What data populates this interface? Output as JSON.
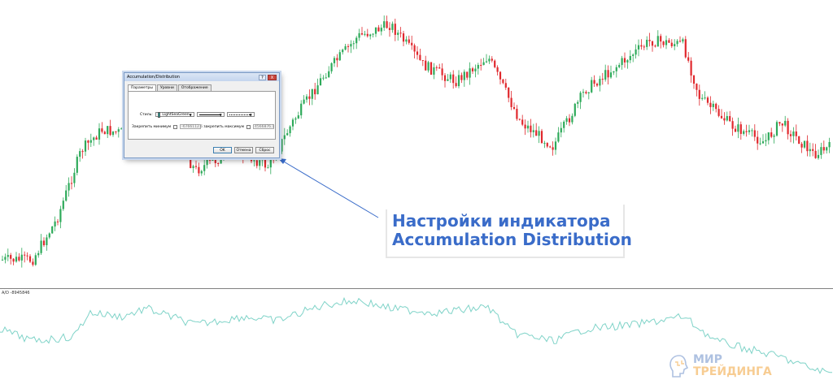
{
  "dialog": {
    "title": "Accumulation/Distribution",
    "help_button": "?",
    "close_button": "X",
    "tabs": [
      "Параметры",
      "Уровни",
      "Отображение"
    ],
    "style_label": "Стиль:",
    "color_name": "LightSeaGreen",
    "color_hex": "#20b2aa",
    "fix_min_label": "Закрепить минимум",
    "fix_min_value": "-6766112.6",
    "fix_max_label": "закрепить максимум",
    "fix_max_value": "4566876.1",
    "ok_label": "OK",
    "cancel_label": "Отмена",
    "reset_label": "Сброс"
  },
  "indicator": {
    "label": "A/D -8945846"
  },
  "annotation": {
    "line1": "Настройки индикатора",
    "line2": "Accumulation Distribution"
  },
  "logo": {
    "line1": "МИР",
    "line2": "ТРЕЙДИНГА"
  },
  "colors": {
    "bull": "#2eaa5a",
    "bear": "#e0282d",
    "ad_line": "#7fd3c8",
    "annotation": "#3a6cc9",
    "separator": "#808080"
  }
}
